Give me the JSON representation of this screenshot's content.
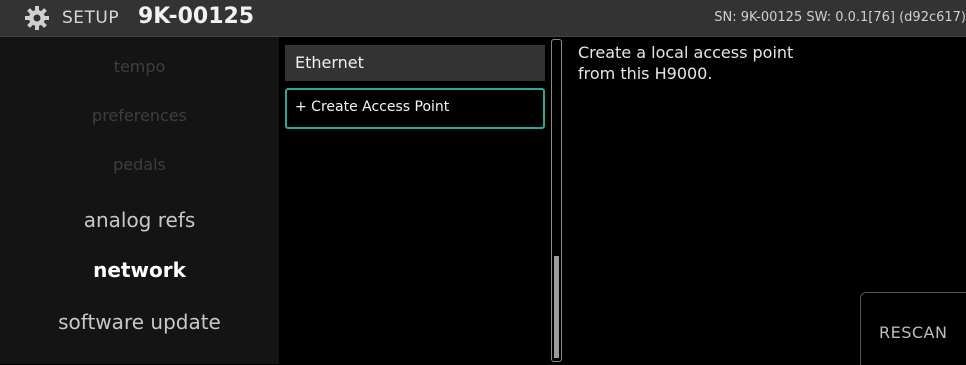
{
  "header": {
    "section": "SETUP",
    "device_name": "9K-00125",
    "info": "SN: 9K-00125 SW: 0.0.1[76] (d92c617)"
  },
  "menu": {
    "items": [
      {
        "label": "tempo",
        "state": "dim"
      },
      {
        "label": "preferences",
        "state": "dim"
      },
      {
        "label": "pedals",
        "state": "dim"
      },
      {
        "label": "analog refs",
        "state": "normal"
      },
      {
        "label": "network",
        "state": "active"
      },
      {
        "label": "software update",
        "state": "normal"
      }
    ]
  },
  "network_list": {
    "header": "Ethernet",
    "items": [
      {
        "label": "+ Create Access Point",
        "selected": true
      }
    ]
  },
  "scrollbar": {
    "thumb_position": 0.68
  },
  "description": {
    "line1": "Create a local access point",
    "line2": "from this H9000."
  },
  "actions": {
    "rescan_label": "RESCAN"
  },
  "colors": {
    "accent": "#2fa596",
    "titlebar": "#333333",
    "menu_bg": "#141414"
  },
  "icons": {
    "header": "gear-icon"
  }
}
